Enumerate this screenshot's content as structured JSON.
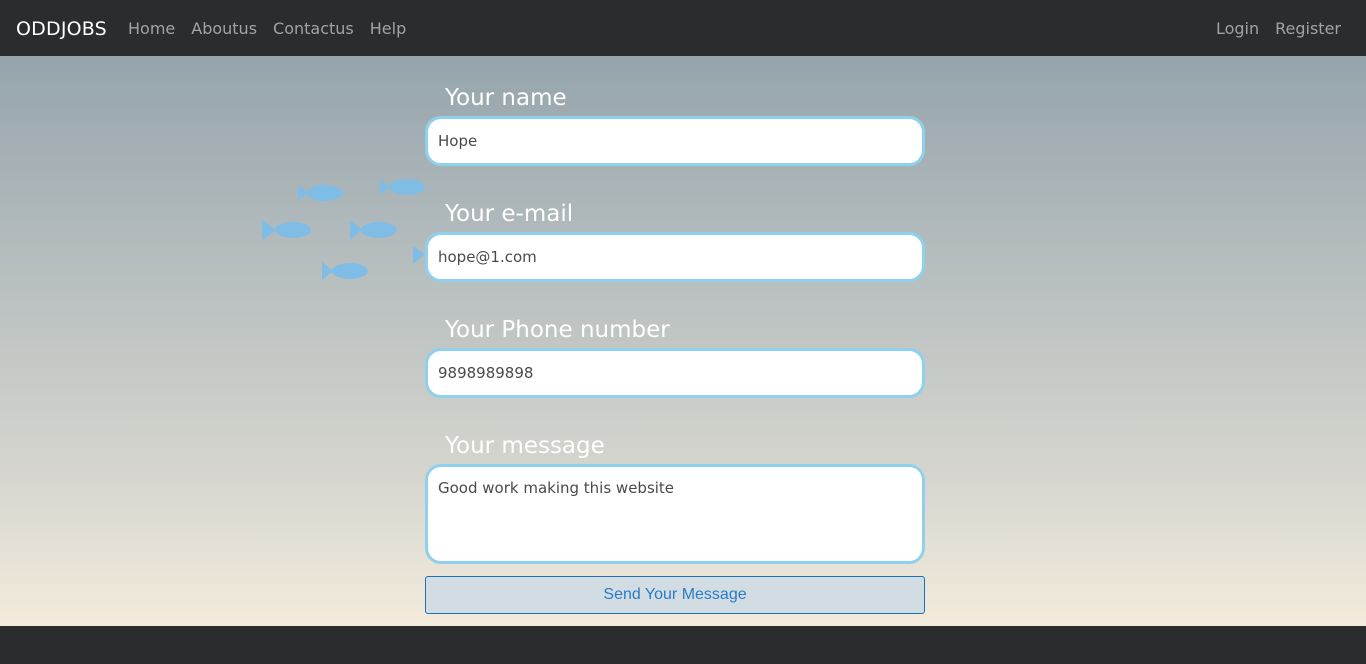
{
  "navbar": {
    "brand": "ODDJOBS",
    "left_links": [
      "Home",
      "Aboutus",
      "Contactus",
      "Help"
    ],
    "right_links": [
      "Login",
      "Register"
    ]
  },
  "form": {
    "name": {
      "label": "Your name",
      "value": "Hope"
    },
    "email": {
      "label": "Your e-mail",
      "value": "hope@1.com"
    },
    "phone": {
      "label": "Your Phone number",
      "value": "9898989898"
    },
    "message": {
      "label": "Your message",
      "value": "Good work making this website"
    },
    "submit_label": "Send Your Message"
  },
  "decoration": {
    "icon": "fish-school",
    "color": "#7fbde6"
  },
  "colors": {
    "navbar_bg": "#2b2c2e",
    "input_border": "#8fd0ee",
    "button_text": "#2a7cc7"
  }
}
